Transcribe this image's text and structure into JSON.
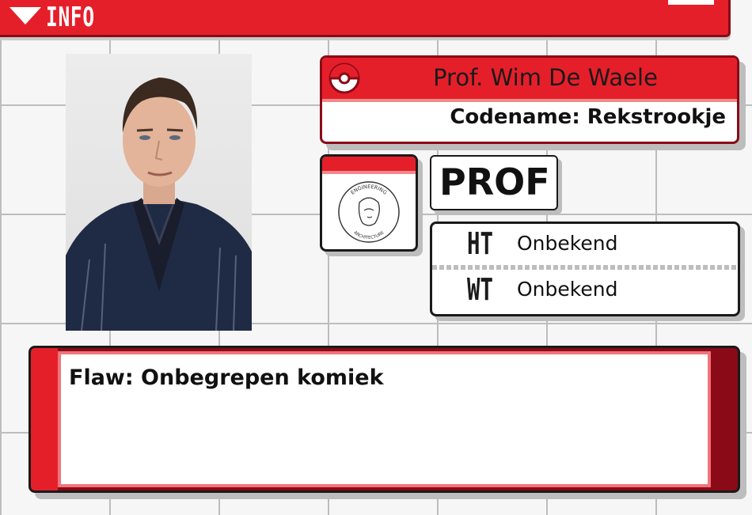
{
  "header": {
    "title": "INFO",
    "icon": "triangle-down-icon"
  },
  "profile": {
    "name": "Prof. Wim De Waele",
    "codename": "Codename: Rekstrookje",
    "type": "PROF",
    "photo_alt": "portrait-photo"
  },
  "logo": {
    "top_text": "ENGINEERING",
    "bottom_text": "ARCHITECTURE"
  },
  "stats": [
    {
      "key": "HT",
      "value": "Onbekend"
    },
    {
      "key": "WT",
      "value": "Onbekend"
    }
  ],
  "flaw": {
    "text": "Flaw: Onbegrepen komiek"
  },
  "colors": {
    "accent_red": "#e51f2a",
    "dark_red": "#8a0a17",
    "pink": "#f08a8a"
  }
}
